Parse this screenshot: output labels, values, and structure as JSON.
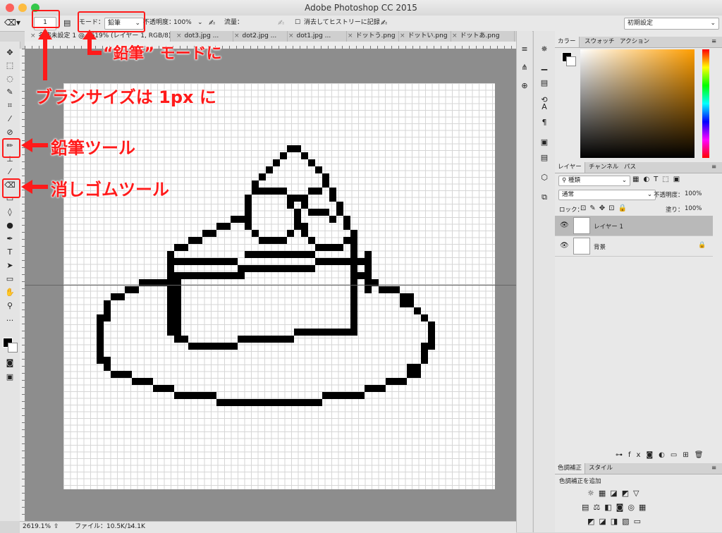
{
  "window": {
    "title": "Adobe Photoshop CC 2015"
  },
  "options_bar": {
    "brush_size": "1",
    "mode_label": "モード：",
    "mode_value": "鉛筆",
    "opacity_label": "不透明度：",
    "opacity_value": "100%",
    "flow_label": "流量：",
    "history_label": "消去してヒストリーに記録",
    "workspace": "初期設定"
  },
  "tabs": [
    "名称未設定 1 @ 2619% (レイヤー 1, RGB/8) *",
    "dot3.jpg ...",
    "dot2.jpg ...",
    "dot1.jpg ...",
    "ドットう.png",
    "ドットい.png",
    "ドットあ.png"
  ],
  "status": {
    "zoom": "2619.1%",
    "file_info": "ファイル：10.5K/14.1K"
  },
  "panels": {
    "color_tabs": [
      "カラー",
      "スウォッチ",
      "アクション"
    ],
    "layer_tabs": [
      "レイヤー",
      "チャンネル",
      "パス"
    ],
    "filter_kind": "種類",
    "blend_mode": "通常",
    "opacity_label": "不透明度：",
    "opacity_value": "100%",
    "lock_label": "ロック：",
    "fill_label": "塗り：",
    "fill_value": "100%",
    "layers": [
      "レイヤー 1",
      "背景"
    ],
    "adjust_tabs": [
      "色調補正",
      "スタイル"
    ],
    "adjust_add": "色調補正を追加"
  },
  "annotations": {
    "pencil_mode": "“鉛筆” モードに",
    "brush_size": "ブラシサイズは 1px に",
    "pencil_tool": "鉛筆ツール",
    "eraser_tool": "消しゴムツール"
  },
  "colors": {
    "accent_red": "#ff1a1a",
    "canvas_gray": "#8d8d8d"
  }
}
